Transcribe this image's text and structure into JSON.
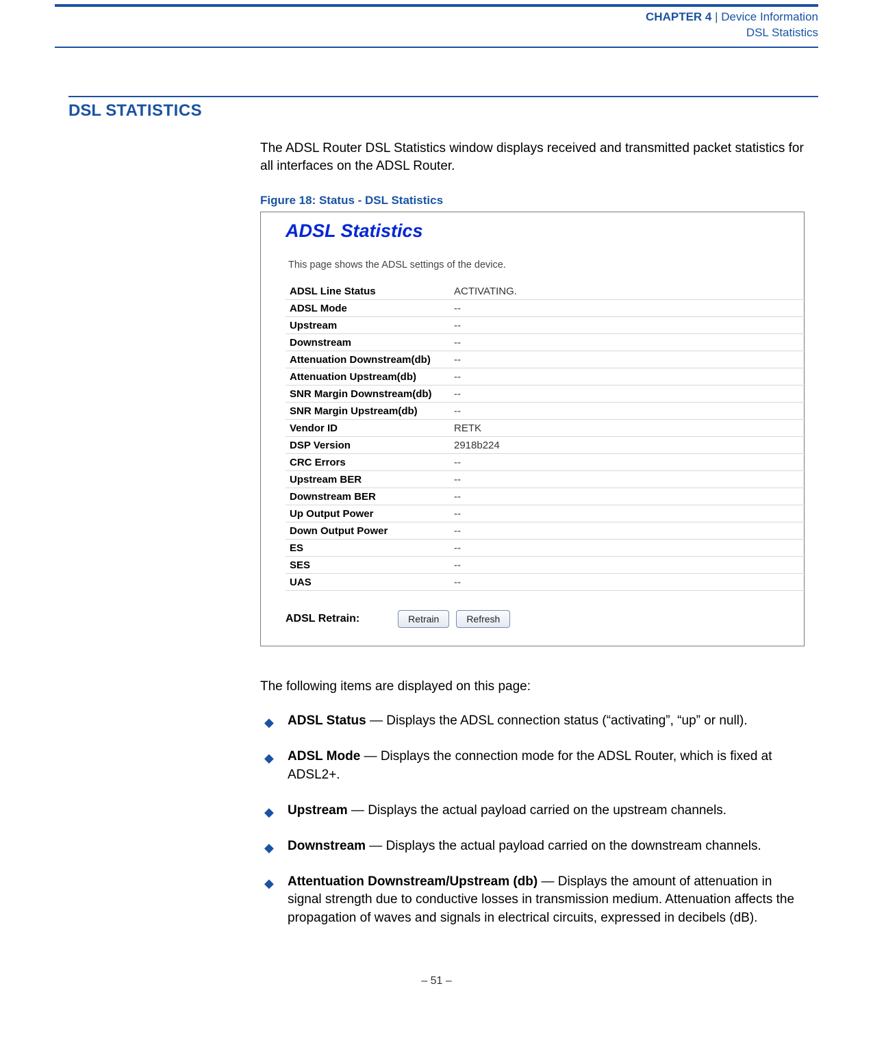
{
  "header": {
    "chapter_label": "CHAPTER 4",
    "separator": "  |  ",
    "device_info": "Device Information",
    "subhead": "DSL Statistics"
  },
  "section": {
    "title_main": "DSL S",
    "title_small": "TATISTICS",
    "intro": "The ADSL Router DSL Statistics window displays received and transmitted packet statistics for all interfaces on the ADSL Router.",
    "figure_caption": "Figure 18:  Status - DSL Statistics"
  },
  "figure": {
    "title": "ADSL Statistics",
    "subtitle": "This page shows the ADSL settings of the device.",
    "rows": [
      {
        "label": "ADSL Line Status",
        "value": "ACTIVATING."
      },
      {
        "label": "ADSL Mode",
        "value": "--"
      },
      {
        "label": "Upstream",
        "value": "--"
      },
      {
        "label": "Downstream",
        "value": "--"
      },
      {
        "label": "Attenuation Downstream(db)",
        "value": "--"
      },
      {
        "label": "Attenuation Upstream(db)",
        "value": "--"
      },
      {
        "label": "SNR Margin Downstream(db)",
        "value": "--"
      },
      {
        "label": "SNR Margin Upstream(db)",
        "value": "--"
      },
      {
        "label": "Vendor ID",
        "value": "RETK"
      },
      {
        "label": "DSP Version",
        "value": "2918b224"
      },
      {
        "label": "CRC Errors",
        "value": "--"
      },
      {
        "label": "Upstream BER",
        "value": "--"
      },
      {
        "label": "Downstream BER",
        "value": "--"
      },
      {
        "label": "Up Output Power",
        "value": "--"
      },
      {
        "label": "Down Output Power",
        "value": "--"
      },
      {
        "label": "ES",
        "value": "--"
      },
      {
        "label": "SES",
        "value": "--"
      },
      {
        "label": "UAS",
        "value": "--"
      }
    ],
    "retrain_label": "ADSL Retrain:",
    "buttons": {
      "retrain": "Retrain",
      "refresh": "Refresh"
    }
  },
  "description": {
    "lead": "The following items are displayed on this page:",
    "items": [
      {
        "term": "ADSL Status",
        "text": " — Displays the ADSL connection status (“activating”, “up” or null)."
      },
      {
        "term": "ADSL Mode",
        "text": " — Displays the connection mode for the ADSL Router, which is fixed at ADSL2+."
      },
      {
        "term": "Upstream",
        "text": " — Displays the actual payload carried on the upstream channels."
      },
      {
        "term": "Downstream",
        "text": " — Displays the actual payload carried on the downstream channels."
      },
      {
        "term": "Attentuation Downstream/Upstream (db)",
        "text": " — Displays the amount of attenuation in signal strength due to conductive losses in transmission medium. Attenuation affects the propagation of waves and signals in electrical circuits, expressed in decibels (dB)."
      }
    ]
  },
  "footer": {
    "page": "–  51  –"
  }
}
